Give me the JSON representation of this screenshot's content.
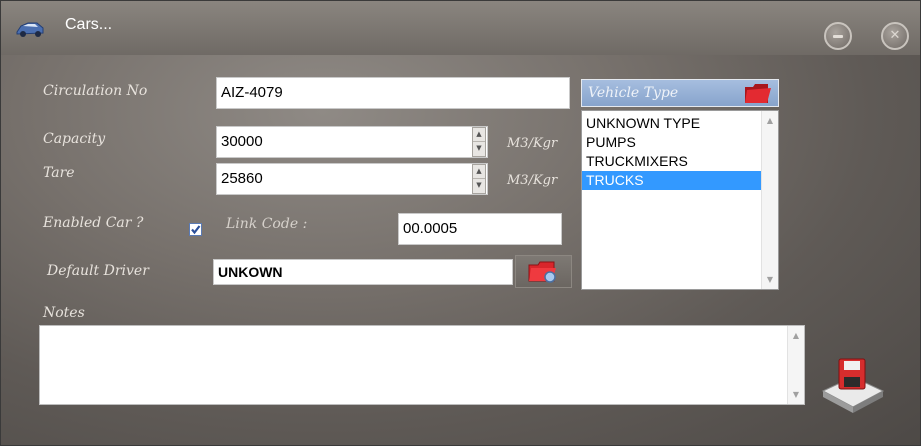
{
  "window": {
    "title": "Cars...",
    "icons": {
      "app": "car-icon",
      "minimize": "minimize-icon",
      "close": "close-icon"
    },
    "close_glyph": "✕"
  },
  "form": {
    "circulation_label": "Circulation No",
    "circulation_value": "AIZ-4079",
    "capacity_label": "Capacity",
    "capacity_value": "30000",
    "capacity_unit": "M3/Kgr",
    "tare_label": "Tare",
    "tare_value": "25860",
    "tare_unit": "M3/Kgr",
    "enabled_label": "Enabled Car ?",
    "enabled_checked": true,
    "link_code_label": "Link Code :",
    "link_code_value": "00.0005",
    "default_driver_label": "Default Driver",
    "default_driver_value": "UNKOWN",
    "notes_label": "Notes",
    "notes_value": ""
  },
  "vehicle_type": {
    "header": "Vehicle Type",
    "items": [
      {
        "label": "UNKNOWN TYPE",
        "selected": false
      },
      {
        "label": "PUMPS",
        "selected": false
      },
      {
        "label": "TRUCKMIXERS",
        "selected": false
      },
      {
        "label": "TRUCKS",
        "selected": true
      }
    ]
  },
  "colors": {
    "selection": "#3399ff",
    "header_blue": "#87a4cc",
    "folder_red": "#d8262b",
    "background": "#77716c"
  }
}
